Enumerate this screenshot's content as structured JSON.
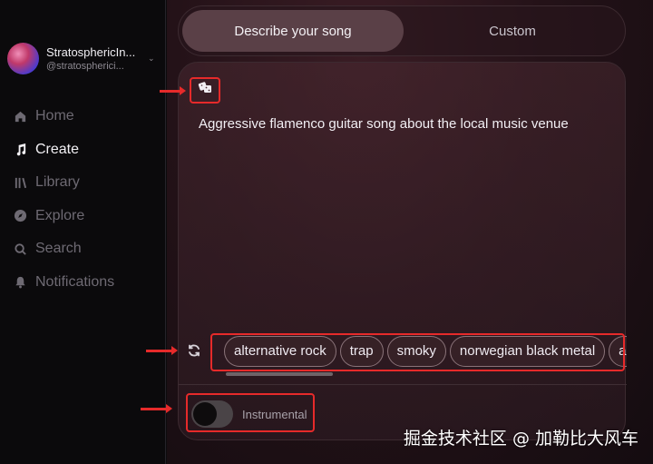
{
  "account": {
    "name": "StratosphericIn...",
    "handle": "@stratospherici..."
  },
  "nav": [
    {
      "label": "Home",
      "icon": "home-icon",
      "active": false
    },
    {
      "label": "Create",
      "icon": "music-note-icon",
      "active": true
    },
    {
      "label": "Library",
      "icon": "library-icon",
      "active": false
    },
    {
      "label": "Explore",
      "icon": "compass-icon",
      "active": false
    },
    {
      "label": "Search",
      "icon": "search-icon",
      "active": false
    },
    {
      "label": "Notifications",
      "icon": "bell-icon",
      "active": false
    }
  ],
  "tabs": {
    "describe": "Describe your song",
    "custom": "Custom"
  },
  "prompt": {
    "text": "Aggressive flamenco guitar song about the local music venue",
    "dice_icon": "dice-icon"
  },
  "style_chips": [
    "alternative rock",
    "trap",
    "smoky",
    "norwegian black metal",
    "am"
  ],
  "refresh_icon": "refresh-icon",
  "instrumental": {
    "label": "Instrumental",
    "enabled": false
  },
  "watermark": "掘金技术社区 @ 加勒比大风车",
  "colors": {
    "highlight": "#e62a2a",
    "accent_tab": "#5a4047"
  }
}
